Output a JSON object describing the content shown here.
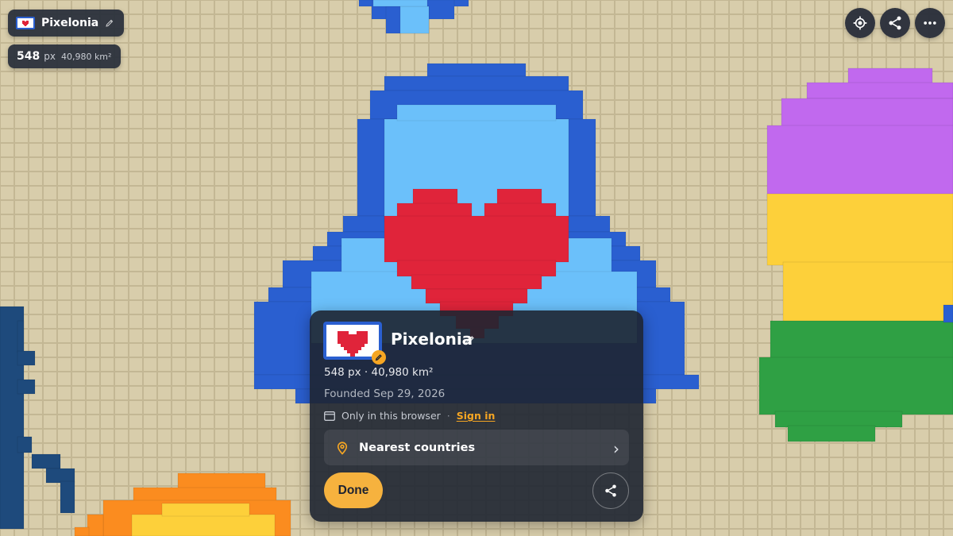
{
  "country": {
    "name": "Pixelonia",
    "pixels": "548",
    "pixels_unit": "px",
    "area": "40,980 km²",
    "stats_line": "548 px · 40,980 km²",
    "founded": "Founded Sep 29, 2026"
  },
  "storage": {
    "text": "Only in this browser",
    "separator": "·",
    "signin_label": "Sign in"
  },
  "actions": {
    "nearest_label": "Nearest countries",
    "done_label": "Done"
  },
  "icons": {
    "locate": "crosshair-icon",
    "share": "share-icon",
    "more": "more-horizontal-icon",
    "edit": "pencil-icon",
    "pin": "map-pin-icon",
    "browser": "browser-window-icon",
    "chevron": "chevron-right-icon"
  },
  "colors": {
    "accent": "#f6a623",
    "heart": "#e0243a",
    "dark_blue": "#2a5fd0",
    "light_blue": "#6bc0fa",
    "land": "#d6cba8",
    "purple": "#c169ee",
    "yellow": "#fdd03a",
    "green": "#2fa044",
    "orange": "#fb8c1f",
    "navy": "#1e4a7c"
  }
}
